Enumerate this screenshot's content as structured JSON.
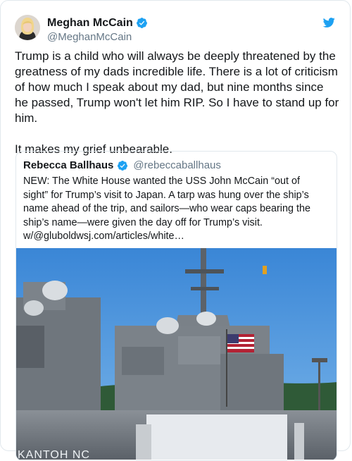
{
  "tweet": {
    "author": {
      "name": "Meghan McCain",
      "handle": "@MeghanMcCain",
      "verified": true
    },
    "text": "Trump is a child who will always be deeply threatened by the greatness of my dads incredible life. There is a lot of criticism of how much I speak about my dad, but nine months since he passed, Trump won't let him RIP. So I have to stand up for him.\n\nIt makes my grief unbearable.",
    "platform_icon": "twitter-bird-icon"
  },
  "quoted_tweet": {
    "author": {
      "name": "Rebecca Ballhaus",
      "handle": "@rebeccaballhaus",
      "verified": true
    },
    "text": "NEW: The White House wanted the USS John McCain “out of sight” for Trump’s visit to Japan. A tarp was hung over the ship’s name ahead of the trip, and sailors—who wear caps bearing the ship’s name—were given the day off for Trump’s visit. w/@gluboldwsj.com/articles/white…",
    "media_caption_text": "KANTOH NC"
  },
  "colors": {
    "text_primary": "#14171a",
    "text_secondary": "#657786",
    "border": "#e1e8ed",
    "verified_blue": "#1da1f2",
    "twitter_blue": "#1da1f2"
  }
}
